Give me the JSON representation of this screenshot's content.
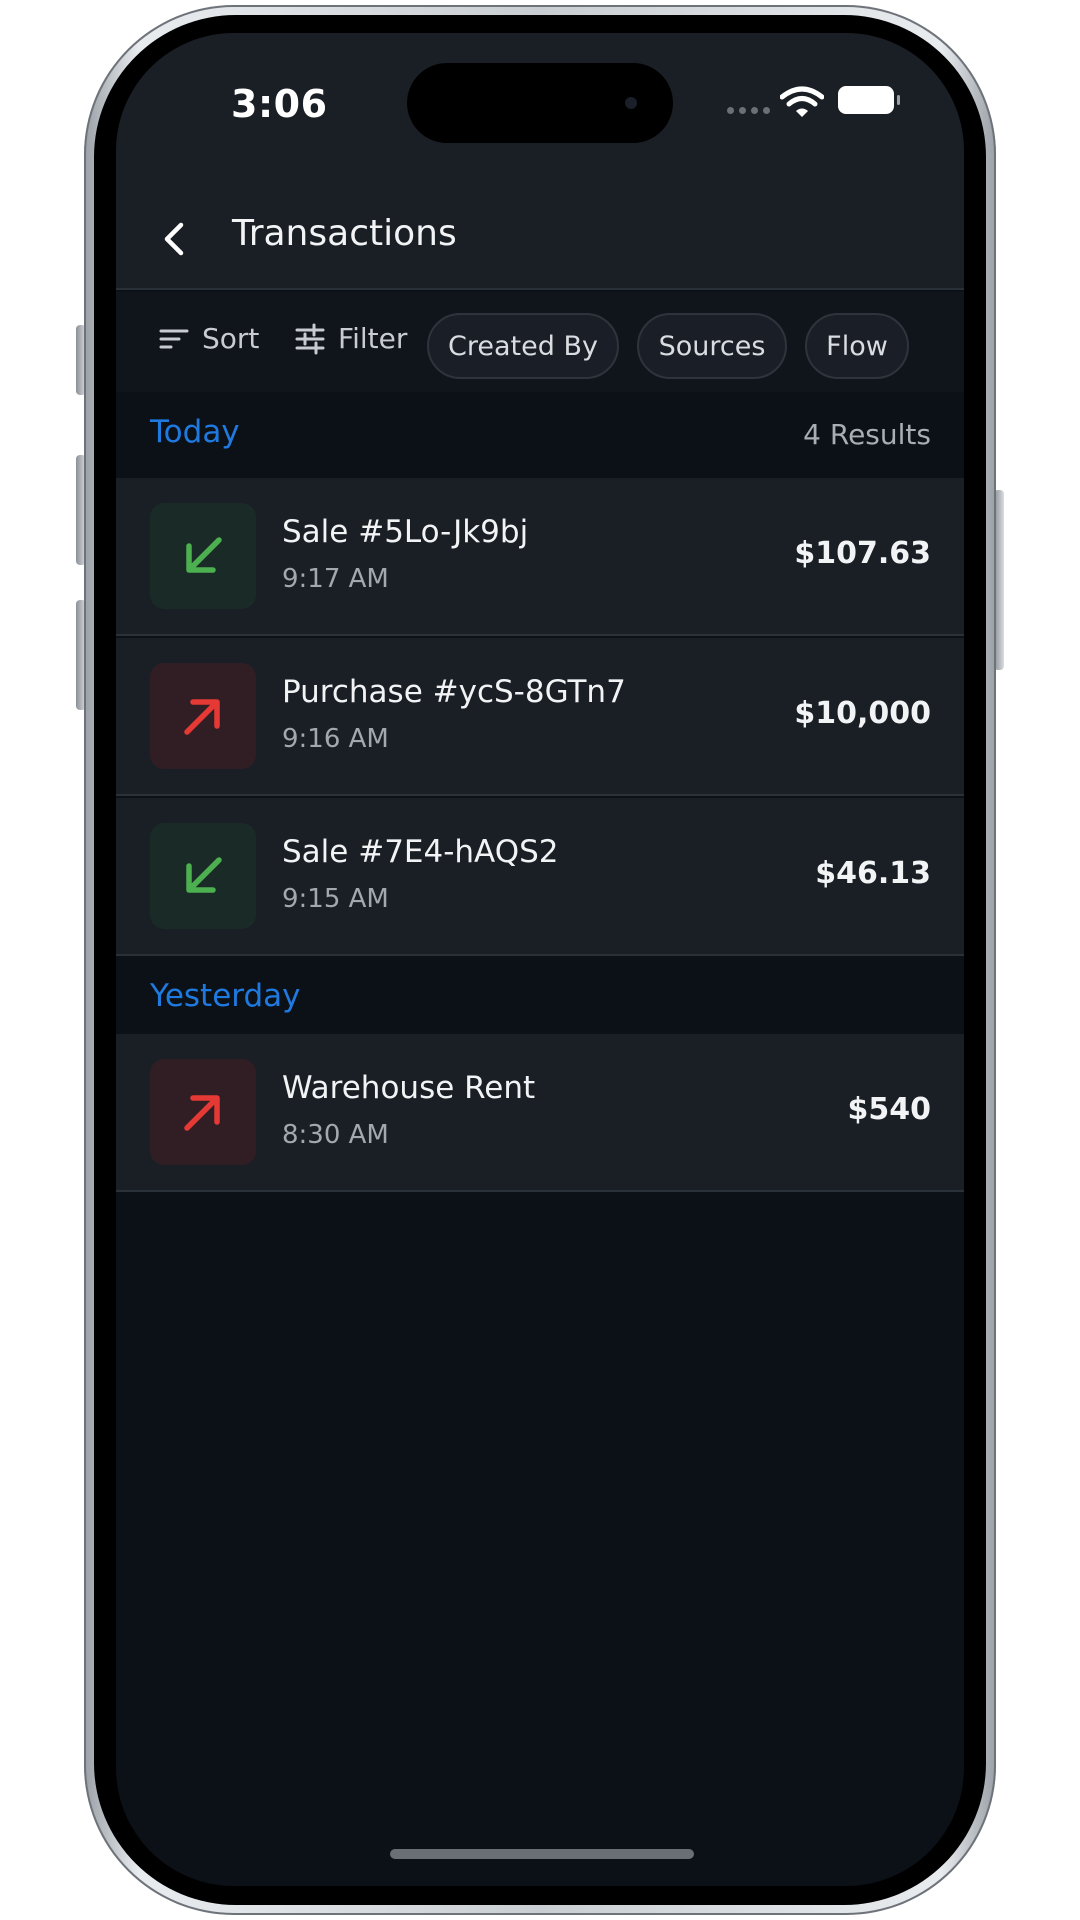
{
  "status_bar": {
    "time": "3:06"
  },
  "header": {
    "title": "Transactions",
    "back_icon": "chevron-left-icon"
  },
  "toolbar": {
    "sort_label": "Sort",
    "filter_label": "Filter",
    "chips": [
      "Created By",
      "Sources",
      "Flow"
    ]
  },
  "sections": [
    {
      "label": "Today",
      "results": "4 Results",
      "items": [
        {
          "title": "Sale #5Lo-Jk9bj",
          "time": "9:17 AM",
          "amount": "$107.63",
          "direction": "in"
        },
        {
          "title": "Purchase #ycS-8GTn7",
          "time": "9:16 AM",
          "amount": "$10,000",
          "direction": "out"
        },
        {
          "title": "Sale #7E4-hAQS2",
          "time": "9:15 AM",
          "amount": "$46.13",
          "direction": "in"
        }
      ]
    },
    {
      "label": "Yesterday",
      "items": [
        {
          "title": "Warehouse Rent",
          "time": "8:30 AM",
          "amount": "$540",
          "direction": "out"
        }
      ]
    }
  ],
  "colors": {
    "background": "#0c1017",
    "surface": "#1a1e25",
    "accent": "#1f7ae0",
    "incoming": "#4caf50",
    "outgoing": "#e53935"
  }
}
